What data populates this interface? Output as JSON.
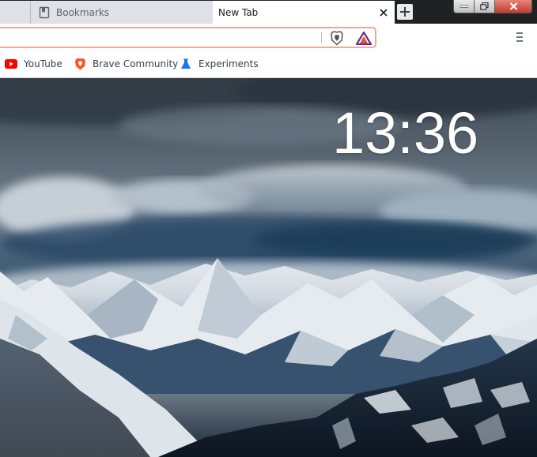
{
  "tabs": [
    {
      "title": "Bookmarks",
      "icon": "bookmark-page-icon",
      "active": false
    },
    {
      "title": "New Tab",
      "active": true
    }
  ],
  "address_bar": {
    "value": "",
    "placeholder": ""
  },
  "bookmarks_bar": [
    {
      "label": "YouTube",
      "icon": "youtube-icon",
      "icon_color": "#ff0000"
    },
    {
      "label": "Brave Community",
      "icon": "brave-lion-icon",
      "icon_color": "#fb542b"
    },
    {
      "label": "Experiments",
      "icon": "flask-icon",
      "icon_color": "#1a73e8"
    }
  ],
  "new_tab_page": {
    "clock": "13:36"
  },
  "colors": {
    "omnibox_border": "#f1a898",
    "brave_orange": "#fb542b",
    "rewards_purple": "#662d91"
  }
}
